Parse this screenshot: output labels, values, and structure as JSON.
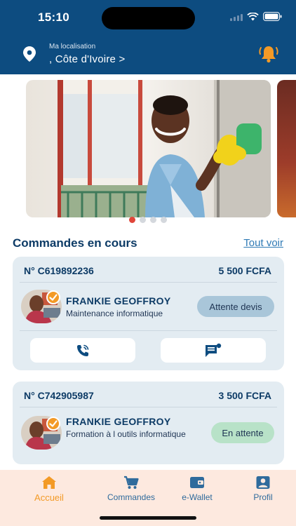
{
  "status_bar": {
    "time": "15:10"
  },
  "header": {
    "location_label": "Ma localisation",
    "location_value": ", Côte d'Ivoire >"
  },
  "carousel": {
    "slide_count": 4,
    "active_index": 0
  },
  "orders_section": {
    "title": "Commandes en cours",
    "see_all": "Tout voir"
  },
  "orders": [
    {
      "number": "N° C619892236",
      "price": "5 500 FCFA",
      "provider": "FRANKIE GEOFFROY",
      "service": "Maintenance informatique",
      "status": "Attente devis",
      "status_color": "#a9c6d9",
      "actions": [
        "phone-call-icon",
        "message-icon"
      ]
    },
    {
      "number": "N° C742905987",
      "price": "3 500 FCFA",
      "provider": "FRANKIE GEOFFROY",
      "service": "Formation à l outils informatique",
      "status": "En attente",
      "status_color": "#b8e2c8"
    }
  ],
  "bottom_nav": {
    "items": [
      {
        "label": "Accueil",
        "icon": "home-icon",
        "active": true
      },
      {
        "label": "Commandes",
        "icon": "cart-icon",
        "active": false
      },
      {
        "label": "e-Wallet",
        "icon": "wallet-icon",
        "active": false
      },
      {
        "label": "Profil",
        "icon": "profile-icon",
        "active": false
      }
    ]
  },
  "colors": {
    "primary": "#0d4c80",
    "accent": "#f39a26",
    "card": "#e3ecf2"
  }
}
